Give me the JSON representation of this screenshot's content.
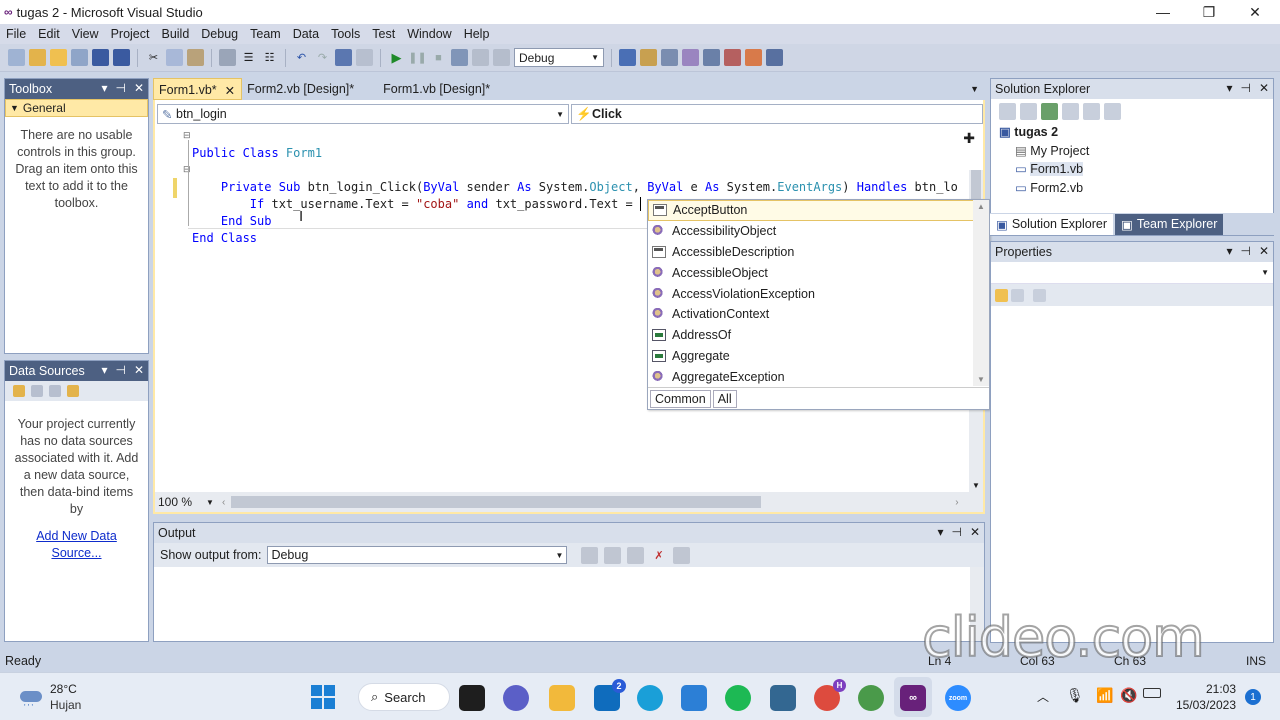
{
  "window": {
    "title": "tugas 2 - Microsoft Visual Studio",
    "minimize": "—",
    "restore": "❐",
    "close": "✕"
  },
  "menu": [
    "File",
    "Edit",
    "View",
    "Project",
    "Build",
    "Debug",
    "Team",
    "Data",
    "Tools",
    "Test",
    "Window",
    "Help"
  ],
  "toolbar": {
    "config": "Debug"
  },
  "toolbox": {
    "title": "Toolbox",
    "group": "General",
    "empty_text": "There are no usable controls in this group. Drag an item onto this text to add it to the toolbox."
  },
  "datasources": {
    "title": "Data Sources",
    "empty_text": "Your project currently has no data sources associated with it. Add a new data source, then data-bind items by",
    "link": "Add New Data Source..."
  },
  "editor": {
    "tabs": [
      {
        "label": "Form1.vb*",
        "close": "✕"
      },
      {
        "label": "Form2.vb [Design]*"
      },
      {
        "label": "Form1.vb [Design]*"
      }
    ],
    "class_combo": "btn_login",
    "method_combo": "Click",
    "zoom": "100 %",
    "code": {
      "l1a": "Public Class",
      "l1b": " Form1",
      "l2a": "    Private Sub",
      "l2b": " btn_login_Click(",
      "l2c": "ByVal",
      "l2d": " sender ",
      "l2e": "As",
      "l2f": " System.",
      "l2g": "Object",
      "l2h": ", ",
      "l2i": "ByVal",
      "l2j": " e ",
      "l2k": "As",
      "l2l": " System.",
      "l2m": "EventArgs",
      "l2n": ") ",
      "l2o": "Handles",
      "l2p": " btn_lo",
      "l3a": "        If",
      "l3b": " txt_username.Text = ",
      "l3c": "\"coba\"",
      "l3d": " ",
      "l3e": "and",
      "l3f": " txt_password.Text = ",
      "l4": "    End Sub",
      "l5": "End Class"
    }
  },
  "intellisense": {
    "items": [
      "AcceptButton",
      "AccessibilityObject",
      "AccessibleDescription",
      "AccessibleObject",
      "AccessViolationException",
      "ActivationContext",
      "AddressOf",
      "Aggregate",
      "AggregateException"
    ],
    "icons": [
      "prop",
      "cls",
      "prop",
      "cls",
      "cls",
      "cls",
      "kw",
      "kw",
      "cls"
    ],
    "tabs": [
      "Common",
      "All"
    ]
  },
  "output": {
    "title": "Output",
    "show_from_label": "Show output from:",
    "show_from_value": "Debug"
  },
  "solution": {
    "title": "Solution Explorer",
    "root": "tugas 2",
    "items": [
      "My Project",
      "Form1.vb",
      "Form2.vb"
    ],
    "tabs": [
      "Solution Explorer",
      "Team Explorer"
    ]
  },
  "properties": {
    "title": "Properties"
  },
  "statusbar": {
    "left": "Ready",
    "ln": "Ln 4",
    "col": "Col 63",
    "ch": "Ch 63",
    "ins": "INS"
  },
  "watermark": "clideo.com",
  "taskbar": {
    "temp": "28°C",
    "weather": "Hujan",
    "search": "Search",
    "time": "21:03",
    "date": "15/03/2023",
    "notif": "1",
    "badge": "2",
    "badge2": "H"
  }
}
